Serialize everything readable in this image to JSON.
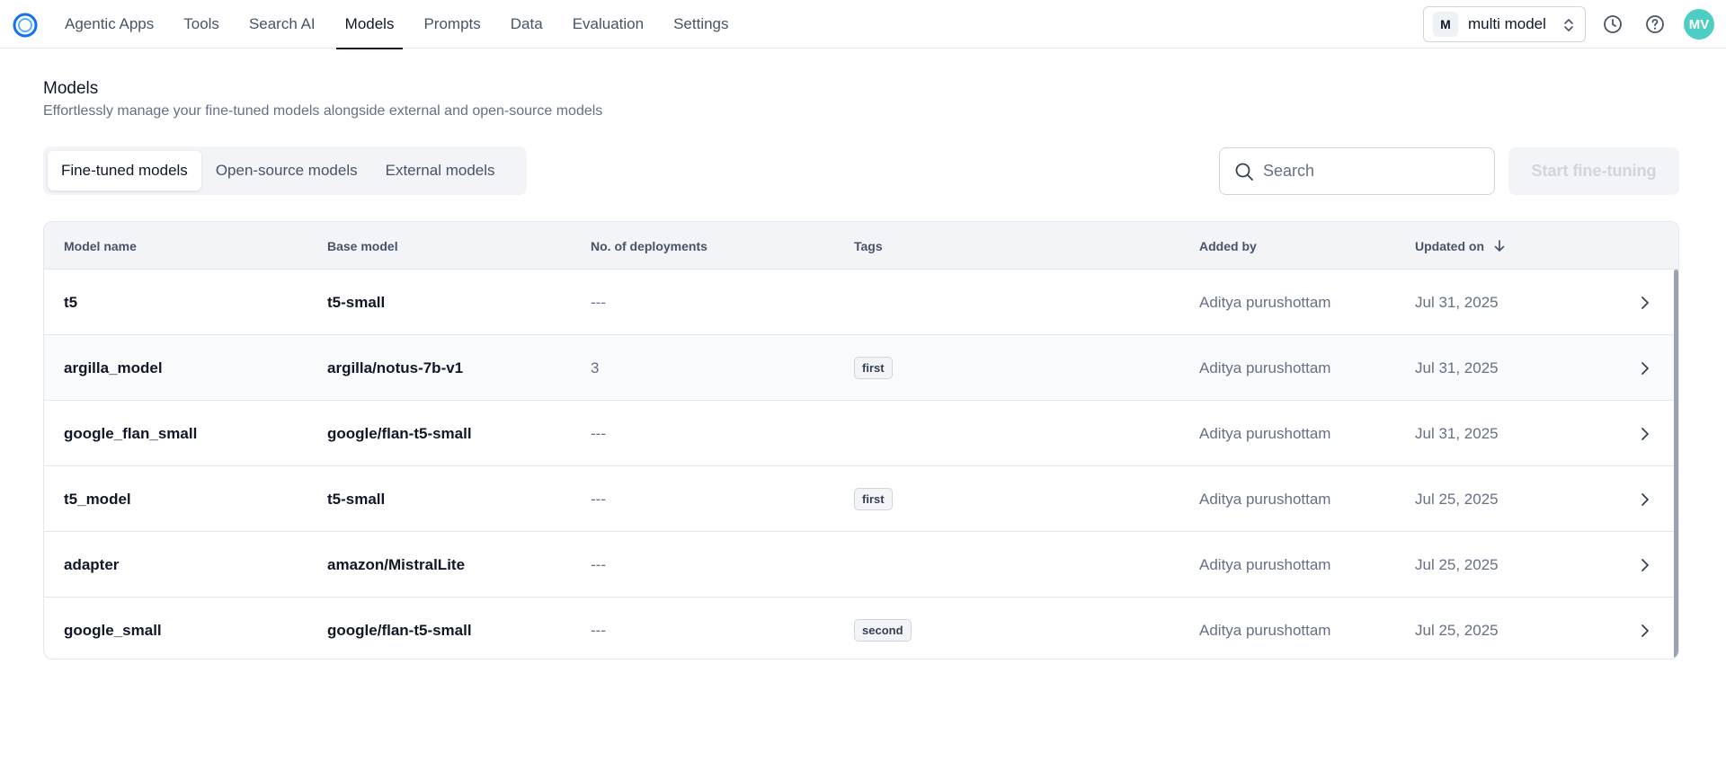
{
  "nav": {
    "items": [
      {
        "label": "Agentic Apps",
        "active": false
      },
      {
        "label": "Tools",
        "active": false
      },
      {
        "label": "Search AI",
        "active": false
      },
      {
        "label": "Models",
        "active": true
      },
      {
        "label": "Prompts",
        "active": false
      },
      {
        "label": "Data",
        "active": false
      },
      {
        "label": "Evaluation",
        "active": false
      },
      {
        "label": "Settings",
        "active": false
      }
    ],
    "workspace": {
      "badge": "M",
      "name": "multi model"
    },
    "avatar": "MV",
    "icons": [
      "history-icon",
      "help-icon",
      "chevron-updown-icon"
    ]
  },
  "header": {
    "title": "Models",
    "subtitle": "Effortlessly manage your fine-tuned models alongside external and open-source models"
  },
  "tabs": [
    {
      "label": "Fine-tuned models",
      "active": true
    },
    {
      "label": "Open-source models",
      "active": false
    },
    {
      "label": "External models",
      "active": false
    }
  ],
  "search": {
    "placeholder": "Search",
    "value": ""
  },
  "actions": {
    "start_label": "Start fine-tuning"
  },
  "table": {
    "columns": [
      "Model name",
      "Base model",
      "No. of deployments",
      "Tags",
      "Added by",
      "Updated on"
    ],
    "rows": [
      {
        "name": "t5",
        "base": "t5-small",
        "deployments": "---",
        "tag": "",
        "added_by": "Aditya purushottam",
        "updated": "Jul 31, 2025"
      },
      {
        "name": "argilla_model",
        "base": "argilla/notus-7b-v1",
        "deployments": "3",
        "tag": "first",
        "added_by": "Aditya purushottam",
        "updated": "Jul 31, 2025"
      },
      {
        "name": "google_flan_small",
        "base": "google/flan-t5-small",
        "deployments": "---",
        "tag": "",
        "added_by": "Aditya purushottam",
        "updated": "Jul 31, 2025"
      },
      {
        "name": "t5_model",
        "base": "t5-small",
        "deployments": "---",
        "tag": "first",
        "added_by": "Aditya purushottam",
        "updated": "Jul 25, 2025"
      },
      {
        "name": "adapter",
        "base": "amazon/MistralLite",
        "deployments": "---",
        "tag": "",
        "added_by": "Aditya purushottam",
        "updated": "Jul 25, 2025"
      },
      {
        "name": "google_small",
        "base": "google/flan-t5-small",
        "deployments": "---",
        "tag": "second",
        "added_by": "Aditya purushottam",
        "updated": "Jul 25, 2025"
      }
    ]
  },
  "colors": {
    "accent": "#1570ef",
    "avatar": "#4ecdc4",
    "text": "#101828",
    "muted": "#667085"
  }
}
